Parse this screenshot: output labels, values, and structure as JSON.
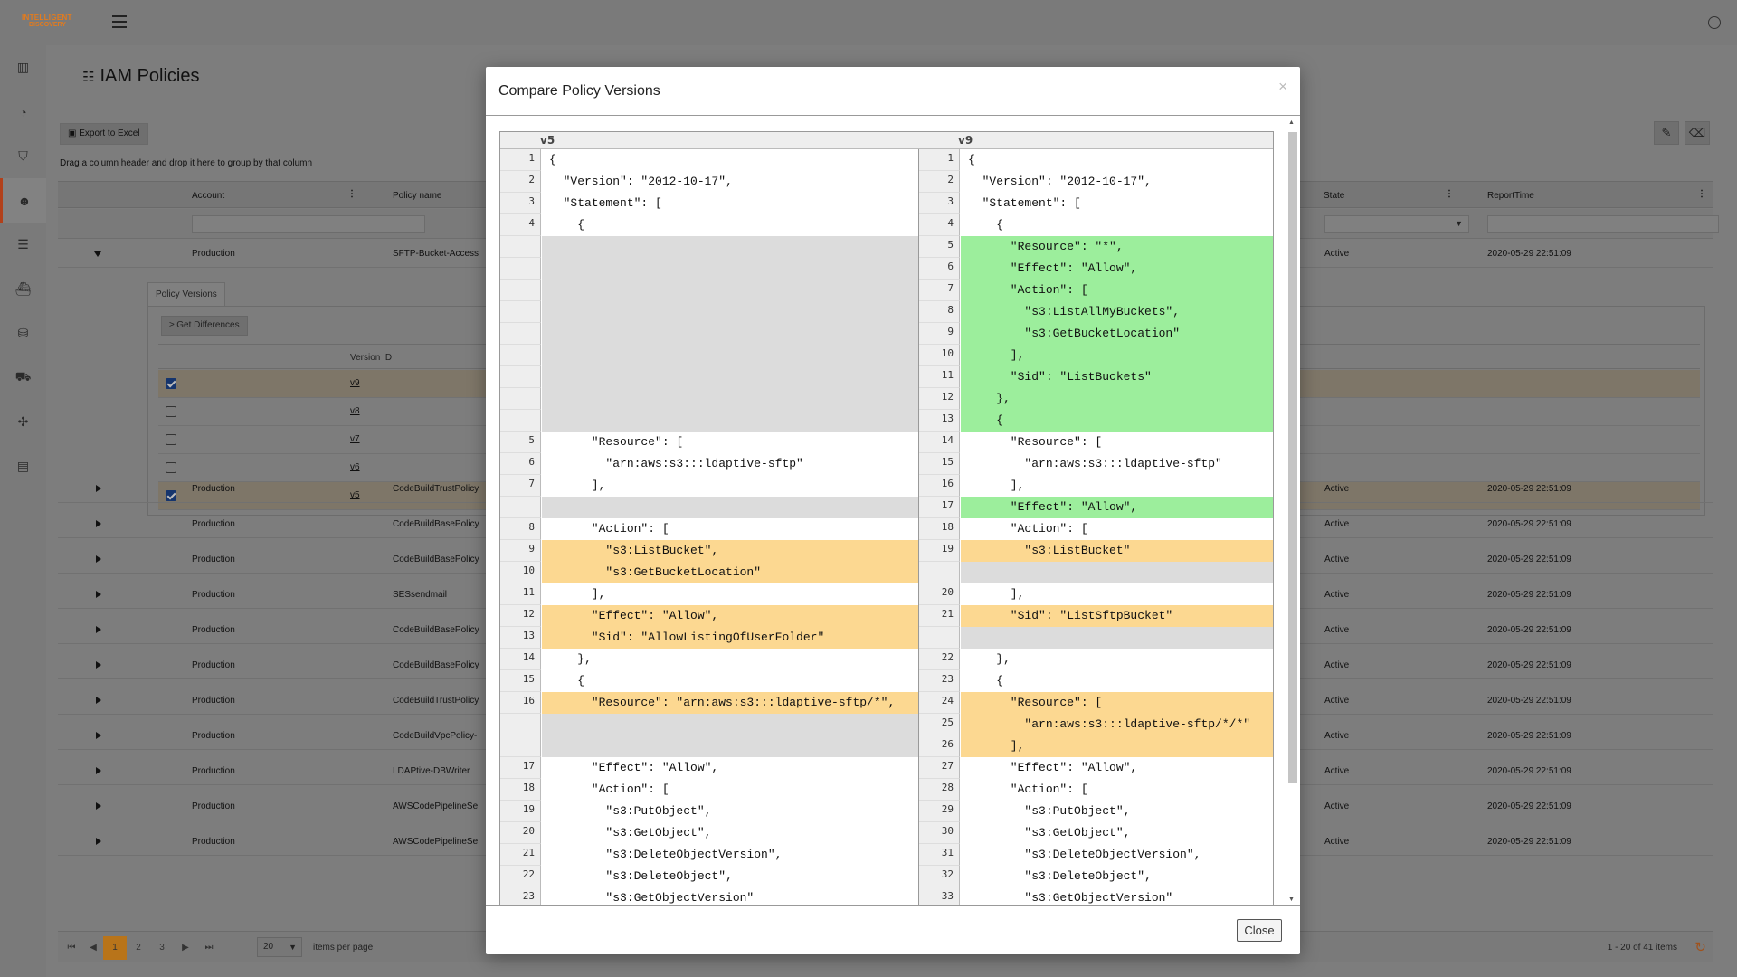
{
  "app": {
    "logo_line1": "INTELLIGENT",
    "logo_line2": "DISCOVERY"
  },
  "page": {
    "title": "IAM Policies",
    "export_label": "Export to Excel",
    "drag_hint": "Drag a column header and drop it here to group by that column",
    "columns": {
      "account": "Account",
      "policy_name": "Policy name",
      "state": "State",
      "report_time": "ReportTime"
    },
    "expanded_row": {
      "account": "Production",
      "policy": "SFTP-Bucket-Access",
      "state": "Active",
      "time": "2020-05-29 22:51:09"
    },
    "policy_versions": {
      "tab_label": "Policy Versions",
      "get_diff_label": "Get Differences",
      "col_version_id": "Version ID",
      "versions": [
        {
          "id": "v9",
          "checked": true
        },
        {
          "id": "v8",
          "checked": false
        },
        {
          "id": "v7",
          "checked": false
        },
        {
          "id": "v6",
          "checked": false
        },
        {
          "id": "v5",
          "checked": true
        }
      ]
    },
    "rows": [
      {
        "account": "Production",
        "policy": "CodeBuildTrustPolicy",
        "state": "Active",
        "time": "2020-05-29 22:51:09"
      },
      {
        "account": "Production",
        "policy": "CodeBuildBasePolicy",
        "state": "Active",
        "time": "2020-05-29 22:51:09"
      },
      {
        "account": "Production",
        "policy": "CodeBuildBasePolicy",
        "state": "Active",
        "time": "2020-05-29 22:51:09"
      },
      {
        "account": "Production",
        "policy": "SESsendmail",
        "state": "Active",
        "time": "2020-05-29 22:51:09"
      },
      {
        "account": "Production",
        "policy": "CodeBuildBasePolicy",
        "state": "Active",
        "time": "2020-05-29 22:51:09"
      },
      {
        "account": "Production",
        "policy": "CodeBuildBasePolicy",
        "state": "Active",
        "time": "2020-05-29 22:51:09"
      },
      {
        "account": "Production",
        "policy": "CodeBuildTrustPolicy",
        "state": "Active",
        "time": "2020-05-29 22:51:09"
      },
      {
        "account": "Production",
        "policy": "CodeBuildVpcPolicy-",
        "state": "Active",
        "time": "2020-05-29 22:51:09"
      },
      {
        "account": "Production",
        "policy": "LDAPtive-DBWriter",
        "state": "Active",
        "time": "2020-05-29 22:51:09"
      },
      {
        "account": "Production",
        "policy": "AWSCodePipelineSe",
        "state": "Active",
        "time": "2020-05-29 22:51:09"
      },
      {
        "account": "Production",
        "policy": "AWSCodePipelineSe",
        "state": "Active",
        "time": "2020-05-29 22:51:09"
      }
    ],
    "pager": {
      "pages": [
        "1",
        "2",
        "3"
      ],
      "current": "1",
      "page_size": "20",
      "items_per_page": "items per page",
      "count": "1 - 20 of 41 items"
    }
  },
  "modal": {
    "title": "Compare Policy Versions",
    "close_x": "×",
    "close_label": "Close",
    "left_label": "v5",
    "right_label": "v9",
    "left_lines": [
      {
        "n": "1",
        "t": "{",
        "k": ""
      },
      {
        "n": "2",
        "t": "  \"Version\": \"2012-10-17\",",
        "k": ""
      },
      {
        "n": "3",
        "t": "  \"Statement\": [",
        "k": ""
      },
      {
        "n": "4",
        "t": "    {",
        "k": ""
      },
      {
        "n": "",
        "t": "",
        "k": "empty"
      },
      {
        "n": "",
        "t": "",
        "k": "empty"
      },
      {
        "n": "",
        "t": "",
        "k": "empty"
      },
      {
        "n": "",
        "t": "",
        "k": "empty"
      },
      {
        "n": "",
        "t": "",
        "k": "empty"
      },
      {
        "n": "",
        "t": "",
        "k": "empty"
      },
      {
        "n": "",
        "t": "",
        "k": "empty"
      },
      {
        "n": "",
        "t": "",
        "k": "empty"
      },
      {
        "n": "",
        "t": "",
        "k": "empty"
      },
      {
        "n": "5",
        "t": "      \"Resource\": [",
        "k": ""
      },
      {
        "n": "6",
        "t": "        \"arn:aws:s3:::ldaptive-sftp\"",
        "k": ""
      },
      {
        "n": "7",
        "t": "      ],",
        "k": ""
      },
      {
        "n": "",
        "t": "",
        "k": "empty"
      },
      {
        "n": "8",
        "t": "      \"Action\": [",
        "k": ""
      },
      {
        "n": "9",
        "t": "        \"s3:ListBucket\",",
        "k": "chg"
      },
      {
        "n": "10",
        "t": "        \"s3:GetBucketLocation\"",
        "k": "chg"
      },
      {
        "n": "11",
        "t": "      ],",
        "k": ""
      },
      {
        "n": "12",
        "t": "      \"Effect\": \"Allow\",",
        "k": "chg"
      },
      {
        "n": "13",
        "t": "      \"Sid\": \"AllowListingOfUserFolder\"",
        "k": "chg"
      },
      {
        "n": "14",
        "t": "    },",
        "k": ""
      },
      {
        "n": "15",
        "t": "    {",
        "k": ""
      },
      {
        "n": "16",
        "t": "      \"Resource\": \"arn:aws:s3:::ldaptive-sftp/*\",",
        "k": "chg"
      },
      {
        "n": "",
        "t": "",
        "k": "empty"
      },
      {
        "n": "",
        "t": "",
        "k": "empty"
      },
      {
        "n": "17",
        "t": "      \"Effect\": \"Allow\",",
        "k": ""
      },
      {
        "n": "18",
        "t": "      \"Action\": [",
        "k": ""
      },
      {
        "n": "19",
        "t": "        \"s3:PutObject\",",
        "k": ""
      },
      {
        "n": "20",
        "t": "        \"s3:GetObject\",",
        "k": ""
      },
      {
        "n": "21",
        "t": "        \"s3:DeleteObjectVersion\",",
        "k": ""
      },
      {
        "n": "22",
        "t": "        \"s3:DeleteObject\",",
        "k": ""
      },
      {
        "n": "23",
        "t": "        \"s3:GetObjectVersion\"",
        "k": ""
      }
    ],
    "right_lines": [
      {
        "n": "1",
        "t": "{",
        "k": ""
      },
      {
        "n": "2",
        "t": "  \"Version\": \"2012-10-17\",",
        "k": ""
      },
      {
        "n": "3",
        "t": "  \"Statement\": [",
        "k": ""
      },
      {
        "n": "4",
        "t": "    {",
        "k": ""
      },
      {
        "n": "5",
        "t": "      \"Resource\": \"*\",",
        "k": "add"
      },
      {
        "n": "6",
        "t": "      \"Effect\": \"Allow\",",
        "k": "add"
      },
      {
        "n": "7",
        "t": "      \"Action\": [",
        "k": "add"
      },
      {
        "n": "8",
        "t": "        \"s3:ListAllMyBuckets\",",
        "k": "add"
      },
      {
        "n": "9",
        "t": "        \"s3:GetBucketLocation\"",
        "k": "add"
      },
      {
        "n": "10",
        "t": "      ],",
        "k": "add"
      },
      {
        "n": "11",
        "t": "      \"Sid\": \"ListBuckets\"",
        "k": "add"
      },
      {
        "n": "12",
        "t": "    },",
        "k": "add"
      },
      {
        "n": "13",
        "t": "    {",
        "k": "add"
      },
      {
        "n": "14",
        "t": "      \"Resource\": [",
        "k": ""
      },
      {
        "n": "15",
        "t": "        \"arn:aws:s3:::ldaptive-sftp\"",
        "k": ""
      },
      {
        "n": "16",
        "t": "      ],",
        "k": ""
      },
      {
        "n": "17",
        "t": "      \"Effect\": \"Allow\",",
        "k": "add"
      },
      {
        "n": "18",
        "t": "      \"Action\": [",
        "k": ""
      },
      {
        "n": "19",
        "t": "        \"s3:ListBucket\"",
        "k": "chg"
      },
      {
        "n": "",
        "t": "",
        "k": "empty"
      },
      {
        "n": "20",
        "t": "      ],",
        "k": ""
      },
      {
        "n": "21",
        "t": "      \"Sid\": \"ListSftpBucket\"",
        "k": "chg"
      },
      {
        "n": "",
        "t": "",
        "k": "empty"
      },
      {
        "n": "22",
        "t": "    },",
        "k": ""
      },
      {
        "n": "23",
        "t": "    {",
        "k": ""
      },
      {
        "n": "24",
        "t": "      \"Resource\": [",
        "k": "chg"
      },
      {
        "n": "25",
        "t": "        \"arn:aws:s3:::ldaptive-sftp/*/*\"",
        "k": "chg"
      },
      {
        "n": "26",
        "t": "      ],",
        "k": "chg"
      },
      {
        "n": "27",
        "t": "      \"Effect\": \"Allow\",",
        "k": ""
      },
      {
        "n": "28",
        "t": "      \"Action\": [",
        "k": ""
      },
      {
        "n": "29",
        "t": "        \"s3:PutObject\",",
        "k": ""
      },
      {
        "n": "30",
        "t": "        \"s3:GetObject\",",
        "k": ""
      },
      {
        "n": "31",
        "t": "        \"s3:DeleteObjectVersion\",",
        "k": ""
      },
      {
        "n": "32",
        "t": "        \"s3:DeleteObject\",",
        "k": ""
      },
      {
        "n": "33",
        "t": "        \"s3:GetObjectVersion\"",
        "k": ""
      }
    ]
  },
  "colors": {
    "added": "#9cee9c",
    "changed": "#fcd891",
    "missing": "#dcdcdc",
    "accent": "#b8741a"
  }
}
